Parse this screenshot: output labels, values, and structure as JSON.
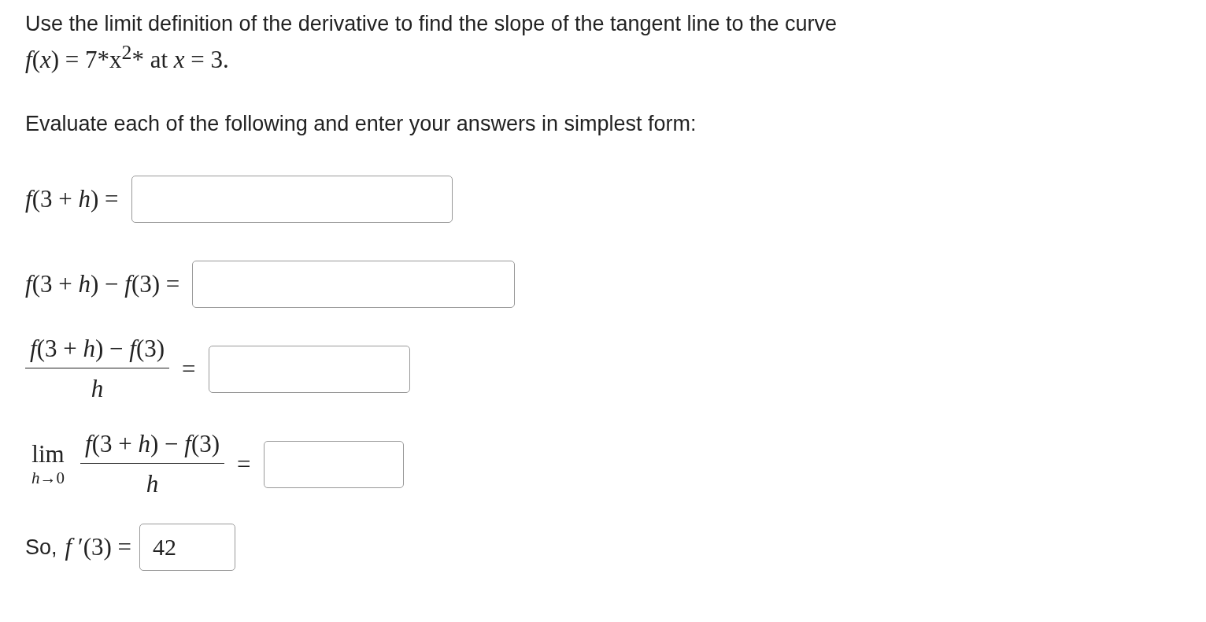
{
  "prompt": [
    "Use the limit definition of the derivative to find the slope of the tangent line to the curve",
    "*f*(*x*) = 7*x$^{2}$* at *x* = 3."
  ],
  "instruction": "Evaluate each of the following and enter your answers in simplest form:",
  "answers": [
    {
      "kind": "plain",
      "expression": "*f*(3 + *h*) ="
    },
    {
      "kind": "plain",
      "expression": "*f*(3 + *h*) − *f*(3) ="
    },
    {
      "kind": "fraction",
      "numerator": "*f*(3 + *h*) − *f*(3)",
      "denominator": "*h*",
      "equals": "="
    },
    {
      "kind": "limit",
      "limit": "lim",
      "subscript": "*h*→0",
      "numerator": "*f*(3 + *h*) − *f*(3)",
      "denominator": "*h*",
      "equals": "="
    },
    {
      "kind": "prefixed",
      "prefix": "So,",
      "expression": "*f* ′(3) =",
      "value": "42"
    }
  ]
}
